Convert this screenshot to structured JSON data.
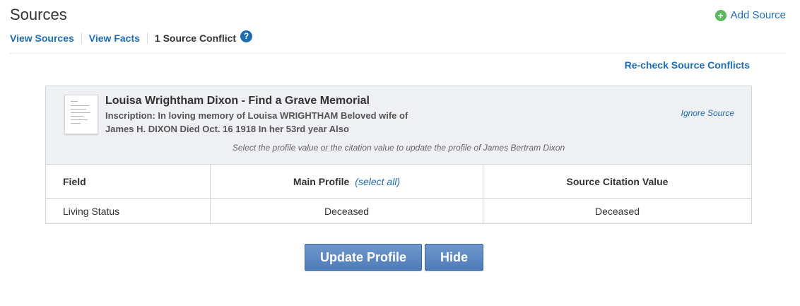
{
  "header": {
    "title": "Sources",
    "add_source_label": "Add Source"
  },
  "subnav": {
    "view_sources": "View Sources",
    "view_facts": "View Facts",
    "conflict_label": "1 Source Conflict",
    "help_glyph": "?"
  },
  "recheck_label": "Re-check Source Conflicts",
  "source": {
    "title": "Louisa Wrightham Dixon - Find a Grave Memorial",
    "inscription": "Inscription: In loving memory of Louisa WRIGHTHAM Beloved wife of James H. DIXON Died Oct. 16 1918 In her 53rd year Also",
    "ignore_label": "Ignore Source",
    "instruction": "Select the profile value or the citation value to update the profile of James Bertram Dixon"
  },
  "table": {
    "headers": {
      "field": "Field",
      "main_profile": "Main Profile",
      "select_all": "(select all)",
      "source_value": "Source Citation Value"
    },
    "rows": [
      {
        "field": "Living Status",
        "main": "Deceased",
        "source": "Deceased"
      }
    ]
  },
  "buttons": {
    "update": "Update Profile",
    "hide": "Hide"
  },
  "icons": {
    "add": "plus-circle-icon",
    "help": "question-circle-icon",
    "thumbnail": "document-thumbnail-icon"
  },
  "colors": {
    "link": "#1f6db4",
    "add_green": "#5cb85c",
    "button": "#5b86bf",
    "panel_bg": "#eef0f3"
  }
}
